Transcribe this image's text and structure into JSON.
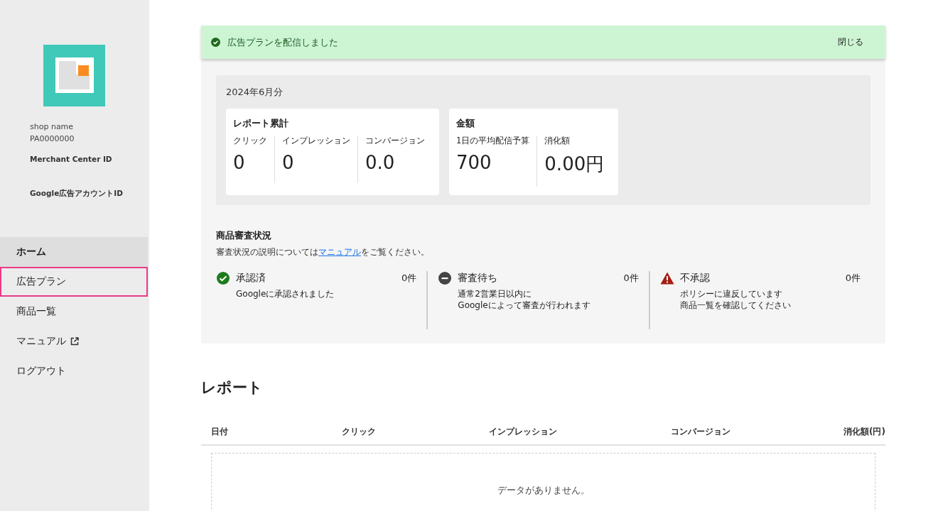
{
  "sidebar": {
    "shop_name": "shop name",
    "shop_id": "PA0000000",
    "merchant_center_label": "Merchant Center ID",
    "google_ads_label": "Google広告アカウントID",
    "items": [
      {
        "label": "ホーム",
        "selected": true,
        "highlighted": false,
        "external": false
      },
      {
        "label": "広告プラン",
        "selected": false,
        "highlighted": true,
        "external": false
      },
      {
        "label": "商品一覧",
        "selected": false,
        "highlighted": false,
        "external": false
      },
      {
        "label": "マニュアル",
        "selected": false,
        "highlighted": false,
        "external": true
      },
      {
        "label": "ログアウト",
        "selected": false,
        "highlighted": false,
        "external": false
      }
    ]
  },
  "toast": {
    "message": "広告プランを配信しました",
    "close": "閉じる"
  },
  "status": {
    "period": "2024年6月分",
    "cards": [
      {
        "title": "レポート累計",
        "metrics": [
          {
            "label": "クリック",
            "value": "0"
          },
          {
            "label": "インプレッション",
            "value": "0"
          },
          {
            "label": "コンバージョン",
            "value": "0.0"
          }
        ]
      },
      {
        "title": "金額",
        "metrics": [
          {
            "label": "1日の平均配信予算",
            "value": "700"
          },
          {
            "label": "消化額",
            "value": "0.00円"
          }
        ]
      }
    ]
  },
  "review": {
    "title": "商品審査状況",
    "note_before": "審査状況の説明については",
    "note_link": "マニュアル",
    "note_after": "をご覧ください。",
    "items": [
      {
        "kind": "approved",
        "label": "承認済",
        "count": "0件",
        "lines": [
          "Googleに承認されました"
        ]
      },
      {
        "kind": "pending",
        "label": "審査待ち",
        "count": "0件",
        "lines": [
          "通常2営業日以内に",
          "Googleによって審査が行われます"
        ]
      },
      {
        "kind": "rejected",
        "label": "不承認",
        "count": "0件",
        "lines": [
          "ポリシーに違反しています",
          "商品一覧を確認してください"
        ]
      }
    ]
  },
  "report": {
    "title": "レポート",
    "columns": [
      "日付",
      "クリック",
      "インプレッション",
      "コンバージョン",
      "消化額(円)"
    ],
    "empty": "データがありません。"
  }
}
